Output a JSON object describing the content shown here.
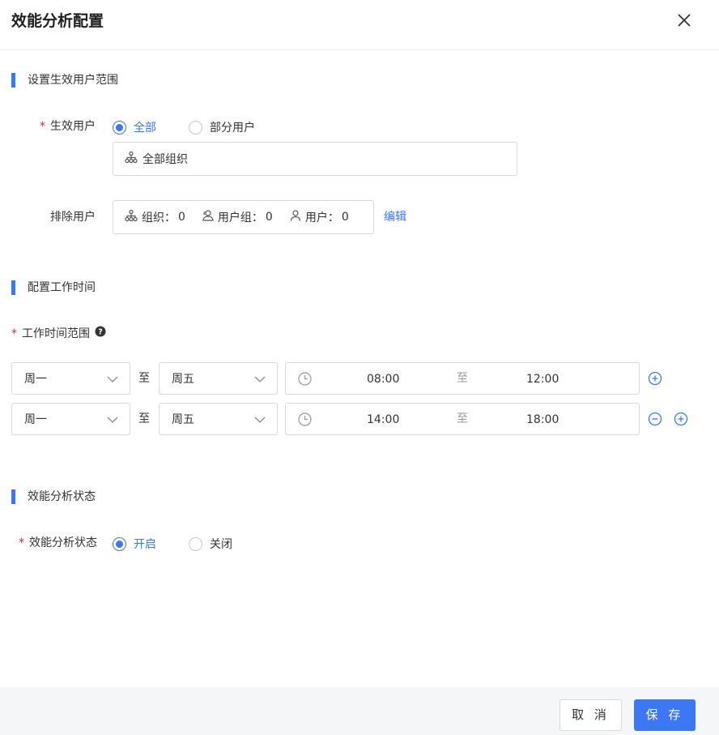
{
  "dialog": {
    "title": "效能分析配置"
  },
  "section_scope": {
    "title": "设置生效用户范围",
    "effective_users": {
      "label": "生效用户",
      "options": [
        "全部",
        "部分用户"
      ],
      "selected": "全部",
      "org_value": "全部组织"
    },
    "exclude_users": {
      "label": "排除用户",
      "org_label": "组织：",
      "org_count": "0",
      "group_label": "用户组：",
      "group_count": "0",
      "user_label": "用户：",
      "user_count": "0",
      "edit_label": "编辑"
    }
  },
  "section_worktime": {
    "title": "配置工作时间",
    "range_label": "工作时间范围",
    "to_label": "至",
    "rows": [
      {
        "day_start": "周一",
        "day_end": "周五",
        "time_start": "08:00",
        "time_end": "12:00"
      },
      {
        "day_start": "周一",
        "day_end": "周五",
        "time_start": "14:00",
        "time_end": "18:00"
      }
    ]
  },
  "section_status": {
    "title": "效能分析状态",
    "label": "效能分析状态",
    "options": [
      "开启",
      "关闭"
    ],
    "selected": "开启"
  },
  "footer": {
    "cancel_label": "取 消",
    "save_label": "保 存"
  },
  "colors": {
    "accent": "#3c77f5",
    "required": "#f5222d",
    "footer_bg": "#f5f6f8"
  },
  "icons": [
    "close-icon",
    "org-icon",
    "user-group-icon",
    "user-icon",
    "help-icon",
    "chevron-down-icon",
    "clock-icon",
    "add-circle-icon",
    "remove-circle-icon"
  ]
}
